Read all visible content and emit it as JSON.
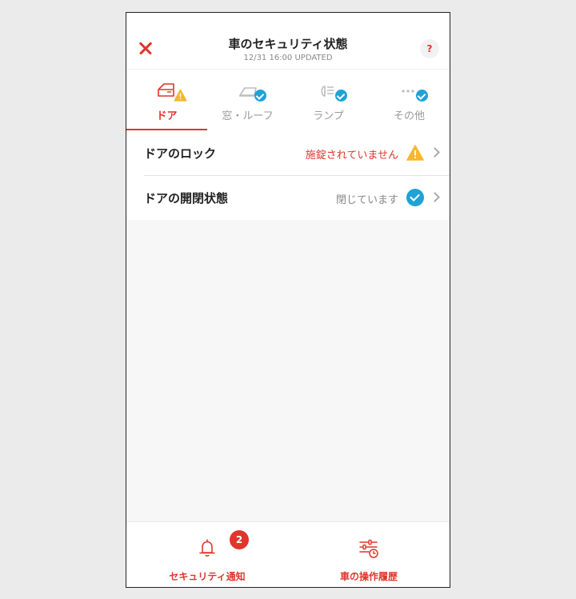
{
  "header": {
    "title": "車のセキュリティ状態",
    "updated": "12/31 16:00 UPDATED",
    "help_label": "?"
  },
  "tabs": [
    {
      "label": "ドア",
      "icon": "door-icon",
      "status": "warning",
      "active": true
    },
    {
      "label": "窓・ルーフ",
      "icon": "window-icon",
      "status": "ok",
      "active": false
    },
    {
      "label": "ランプ",
      "icon": "lamp-icon",
      "status": "ok",
      "active": false
    },
    {
      "label": "その他",
      "icon": "more-icon",
      "status": "ok",
      "active": false
    }
  ],
  "rows": [
    {
      "label": "ドアのロック",
      "status": "施錠されていません",
      "state": "warning"
    },
    {
      "label": "ドアの開閉状態",
      "status": "閉じています",
      "state": "ok"
    }
  ],
  "bottom": {
    "notifications_label": "セキュリティ通知",
    "notifications_count": "2",
    "history_label": "車の操作履歴"
  },
  "colors": {
    "accent": "#e0352b",
    "ok": "#1fa2d6",
    "warning": "#f5b731"
  }
}
